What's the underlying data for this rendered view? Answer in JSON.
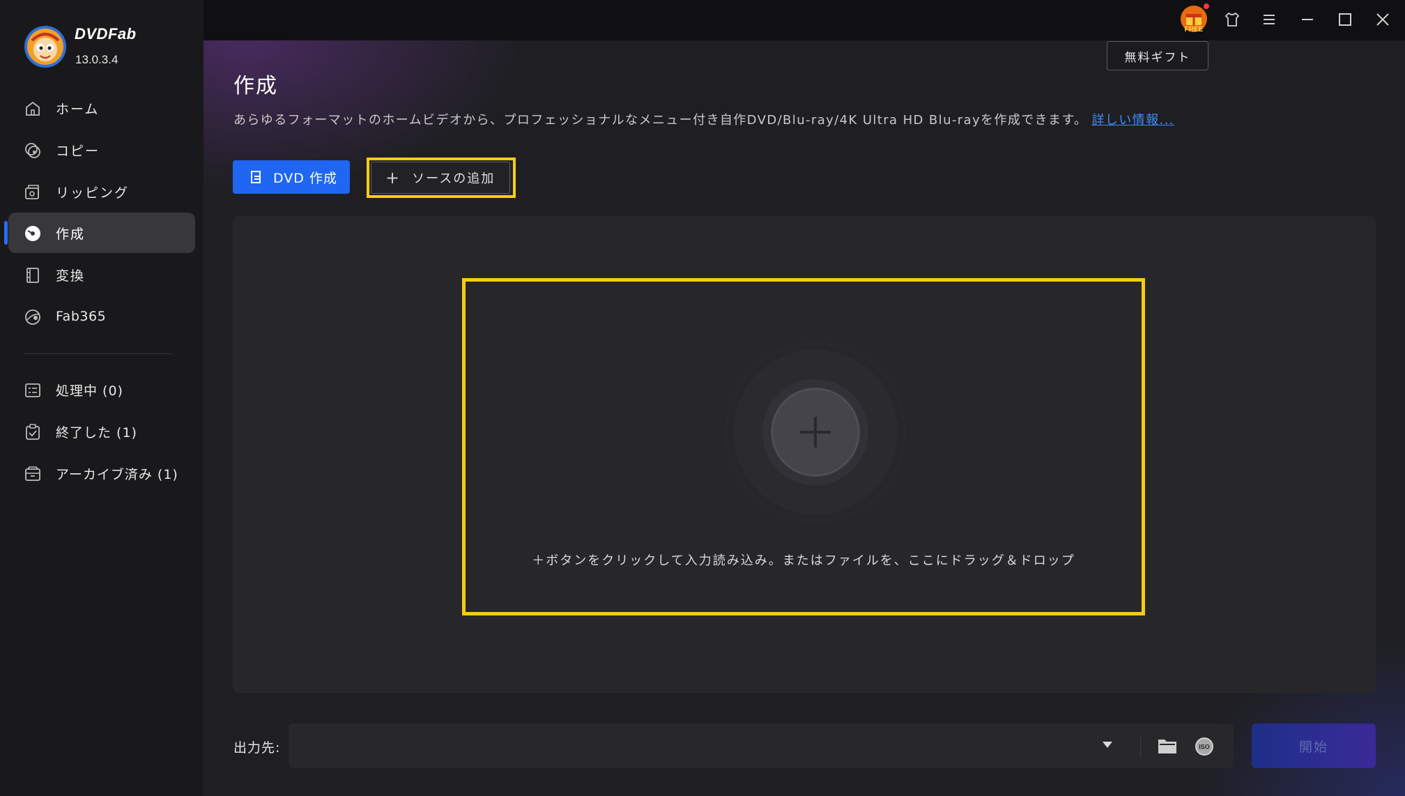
{
  "app": {
    "brand": "DVDFab",
    "version": "13.0.3.4"
  },
  "sidebar": {
    "items": [
      {
        "label": "ホーム",
        "icon": "home-icon"
      },
      {
        "label": "コピー",
        "icon": "copy-disc-icon"
      },
      {
        "label": "リッピング",
        "icon": "ripping-icon"
      },
      {
        "label": "作成",
        "icon": "creator-disc-icon",
        "active": true
      },
      {
        "label": "変換",
        "icon": "film-icon"
      },
      {
        "label": "Fab365",
        "icon": "fab365-icon"
      }
    ],
    "tasks": [
      {
        "label": "処理中 (0)",
        "icon": "processing-list-icon"
      },
      {
        "label": "終了した (1)",
        "icon": "finished-clipboard-icon"
      },
      {
        "label": "アーカイブ済み (1)",
        "icon": "archive-box-icon"
      }
    ]
  },
  "topbar": {
    "gift_label": "無料ギフト",
    "free_badge": "FREE",
    "icons": [
      "free-gift-icon",
      "shirt-icon",
      "menu-icon",
      "minimize-icon",
      "maximize-icon",
      "close-icon"
    ]
  },
  "main": {
    "title": "作成",
    "description": "あらゆるフォーマットのホームビデオから、プロフェッショナルなメニュー付き自作DVD/Blu-ray/4K Ultra HD Blu-rayを作成できます。",
    "more_link": "詳しい情報...",
    "dvd_button": "DVD 作成",
    "add_source": "ソースの追加",
    "drop_hint": "＋ボタンをクリックして入力読み込み。またはファイルを、ここにドラッグ＆ドロップ"
  },
  "footer": {
    "output_label": "出力先:",
    "output_value": "",
    "start_button": "開始",
    "iso_label": "ISO"
  },
  "colors": {
    "accent": "#1f66f2",
    "highlight": "#f5cc16",
    "link": "#3d8bff",
    "sidebar_bg": "#19191b",
    "panel_bg": "#27272a"
  }
}
